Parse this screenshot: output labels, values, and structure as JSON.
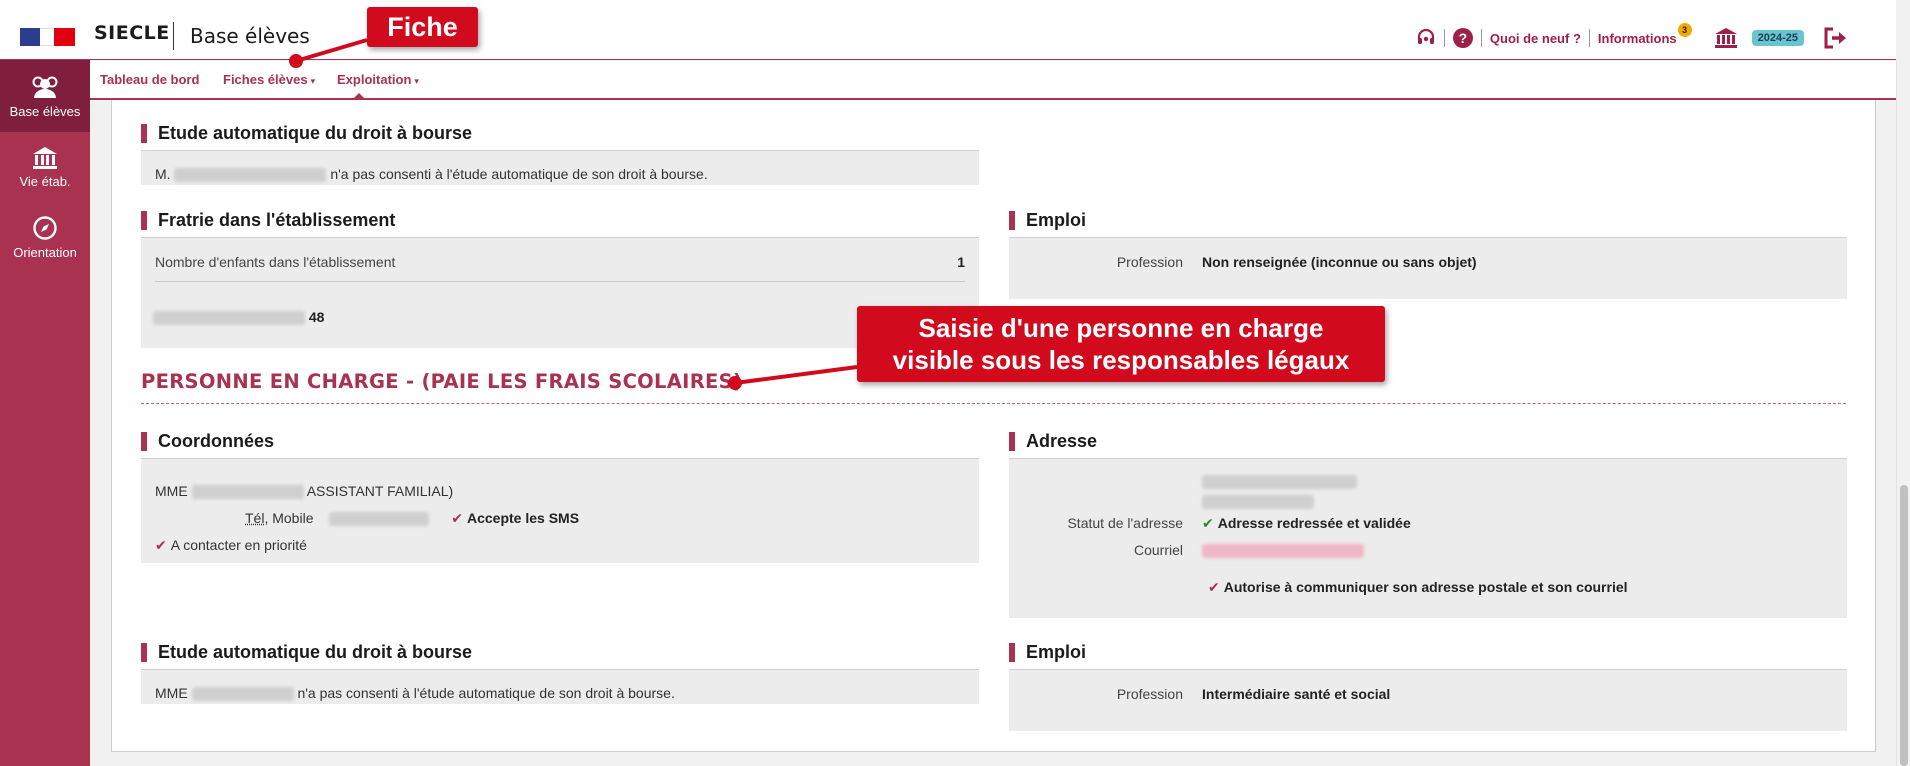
{
  "header": {
    "app_name": "SIECLE",
    "module_name": "Base élèves",
    "quoi_de_neuf": "Quoi de neuf ?",
    "informations": "Informations",
    "informations_count": "3",
    "school_year": "2024-25",
    "icons": [
      "headset-icon",
      "help-icon",
      "institution-icon",
      "logout-icon"
    ]
  },
  "sidebar": {
    "items": [
      {
        "label": "Base élèves",
        "icon": "users-icon",
        "active": true
      },
      {
        "label": "Vie étab.",
        "icon": "institution-icon",
        "active": false
      },
      {
        "label": "Orientation",
        "icon": "compass-icon",
        "active": false
      }
    ]
  },
  "subnav": {
    "tableau": "Tableau de bord",
    "fiches": "Fiches élèves",
    "exploitation": "Exploitation"
  },
  "annotations": {
    "fiche": "Fiche",
    "personne_line1": "Saisie d'une personne en charge",
    "personne_line2": "visible sous les responsables légaux"
  },
  "student": {
    "bourse_title": "Etude automatique du droit à bourse",
    "bourse_prefix": "M.",
    "bourse_text": "n'a pas consenti à l'étude automatique de son droit à bourse.",
    "fratrie_title": "Fratrie dans l'établissement",
    "fratrie_label": "Nombre d'enfants dans l'établissement",
    "fratrie_count": "1",
    "fratrie_sibling_suffix": "48",
    "emploi_title": "Emploi",
    "profession_label": "Profession",
    "profession_value": "Non renseignée (inconnue ou sans objet)"
  },
  "personne": {
    "heading": "PERSONNE EN CHARGE - (PAIE LES FRAIS SCOLAIRES)",
    "coord_title": "Coordonnées",
    "civilite": "MME",
    "role": "ASSISTANT FAMILIAL)",
    "tel_label_abbr": "Tél",
    "tel_label_rest": ", Mobile",
    "sms": "Accepte les SMS",
    "priorite": "A contacter en priorité",
    "adresse_title": "Adresse",
    "statut_label": "Statut de l'adresse",
    "statut_value": "Adresse redressée et validée",
    "courriel_label": "Courriel",
    "autorise": "Autorise à communiquer son adresse postale et son courriel",
    "bourse_title": "Etude automatique du droit à bourse",
    "bourse_prefix": "MME",
    "bourse_text": "n'a pas consenti à l'étude automatique de son droit à bourse.",
    "emploi_title": "Emploi",
    "profession_label": "Profession",
    "profession_value": "Intermédiaire santé et social"
  },
  "colors": {
    "brand": "#a8324f",
    "brand_dark": "#7f1e3d",
    "annotation": "#d10a1d",
    "badge": "#69c4cf"
  }
}
